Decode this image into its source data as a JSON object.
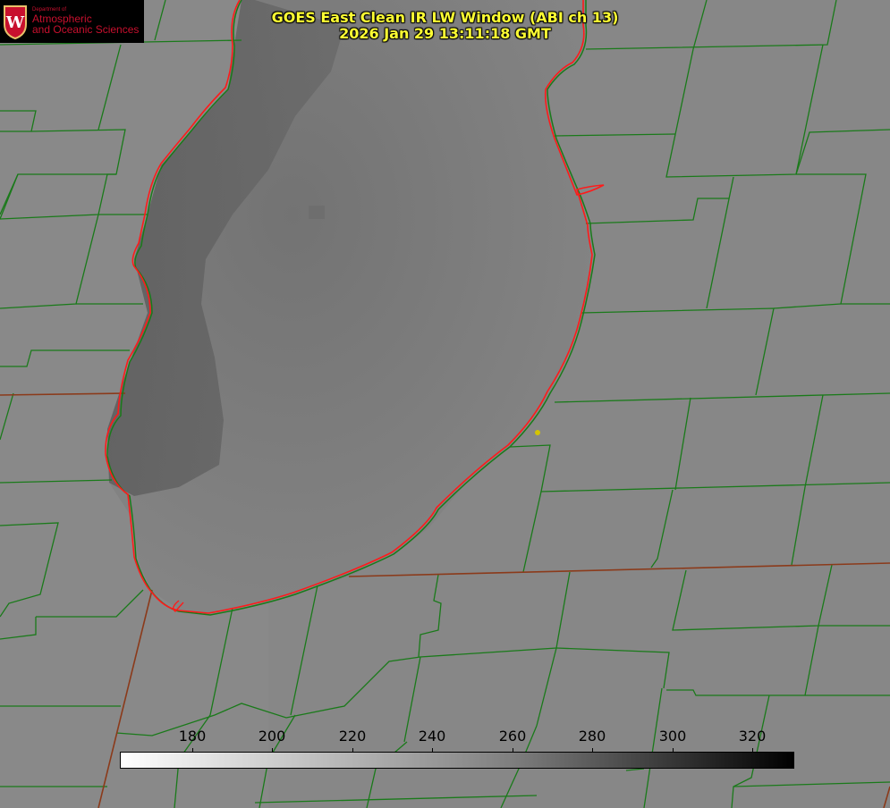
{
  "title": {
    "line1": "GOES East Clean IR LW Window (ABI ch 13)",
    "line2": "2026 Jan 29 13:11:18 GMT"
  },
  "logo": {
    "dept_small": "Department of",
    "dept_line1": "Atmospheric",
    "dept_line2": "and Oceanic Sciences",
    "icon": "uw-crest-icon"
  },
  "colorbar": {
    "tick_labels": [
      "180",
      "200",
      "220",
      "240",
      "260",
      "280",
      "300",
      "320"
    ]
  },
  "colors": {
    "county_lines": "#1a7a1a",
    "state_lines": "#8b3a1a",
    "lake_outline": "#ff1a1a",
    "title": "#ffff33",
    "marker": "#d4c400"
  }
}
